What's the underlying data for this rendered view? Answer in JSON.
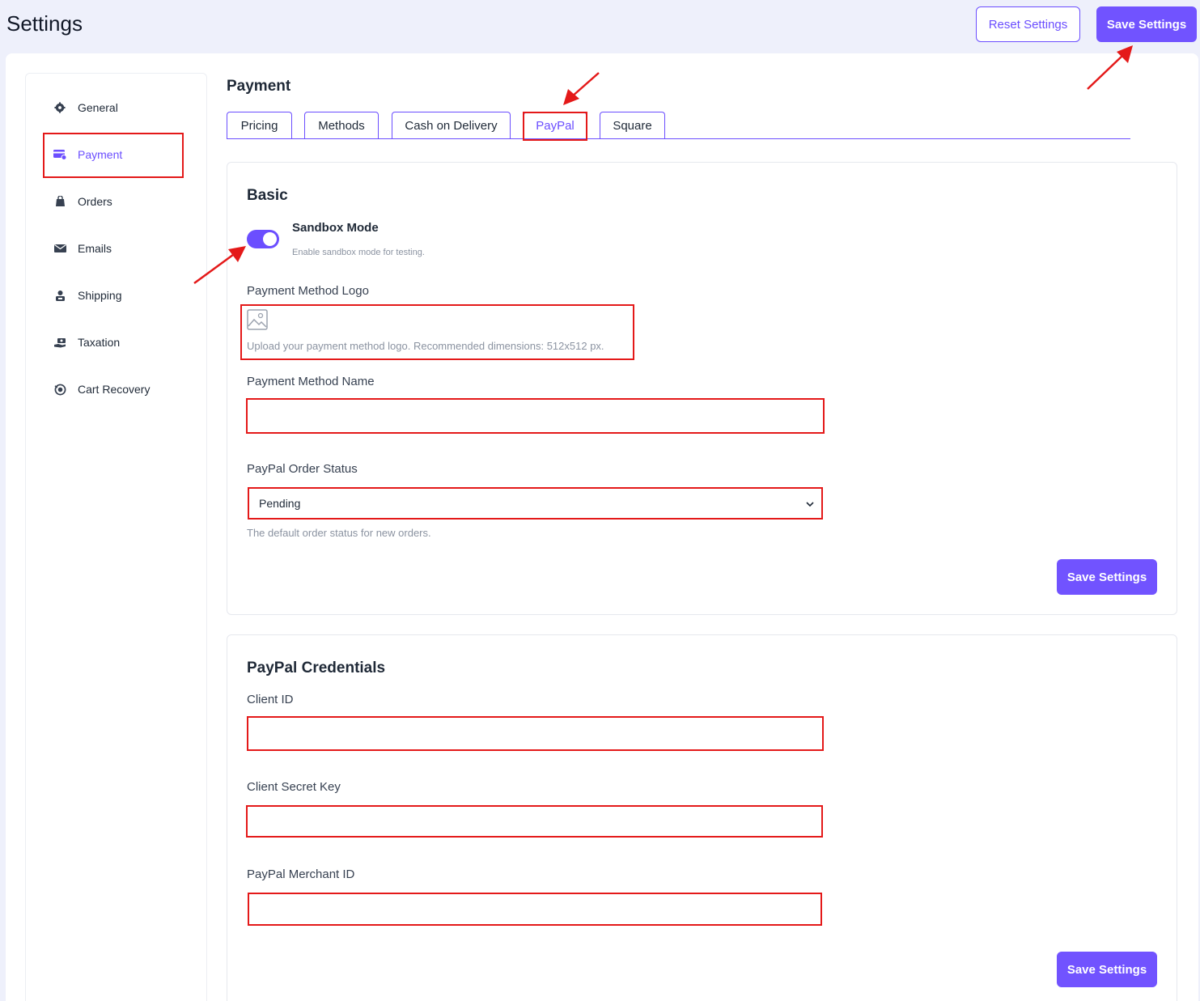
{
  "header": {
    "title": "Settings",
    "reset_label": "Reset Settings",
    "save_label": "Save Settings"
  },
  "sidebar": {
    "items": [
      {
        "label": "General",
        "icon": "gear-icon"
      },
      {
        "label": "Payment",
        "icon": "credit-card-icon",
        "active": true
      },
      {
        "label": "Orders",
        "icon": "shopping-bag-icon"
      },
      {
        "label": "Emails",
        "icon": "envelope-icon"
      },
      {
        "label": "Shipping",
        "icon": "person-box-icon"
      },
      {
        "label": "Taxation",
        "icon": "money-hand-icon"
      },
      {
        "label": "Cart Recovery",
        "icon": "recovery-icon"
      }
    ]
  },
  "main": {
    "section_title": "Payment",
    "tabs": [
      {
        "label": "Pricing"
      },
      {
        "label": "Methods"
      },
      {
        "label": "Cash on Delivery"
      },
      {
        "label": "PayPal",
        "active": true
      },
      {
        "label": "Square"
      }
    ]
  },
  "basic": {
    "title": "Basic",
    "sandbox_label": "Sandbox Mode",
    "sandbox_help": "Enable sandbox mode for testing.",
    "sandbox_enabled": true,
    "logo_label": "Payment Method Logo",
    "logo_help": "Upload your payment method logo. Recommended dimensions: 512x512 px.",
    "name_label": "Payment Method Name",
    "name_value": "",
    "status_label": "PayPal Order Status",
    "status_value": "Pending",
    "status_help": "The default order status for new orders.",
    "save_label": "Save Settings"
  },
  "credentials": {
    "title": "PayPal Credentials",
    "client_id_label": "Client ID",
    "client_id_value": "",
    "client_secret_label": "Client Secret Key",
    "client_secret_value": "",
    "merchant_id_label": "PayPal Merchant ID",
    "merchant_id_value": "",
    "save_label": "Save Settings"
  },
  "colors": {
    "accent": "#7153ff",
    "highlight": "#e41919",
    "background": "#eef0fb"
  }
}
